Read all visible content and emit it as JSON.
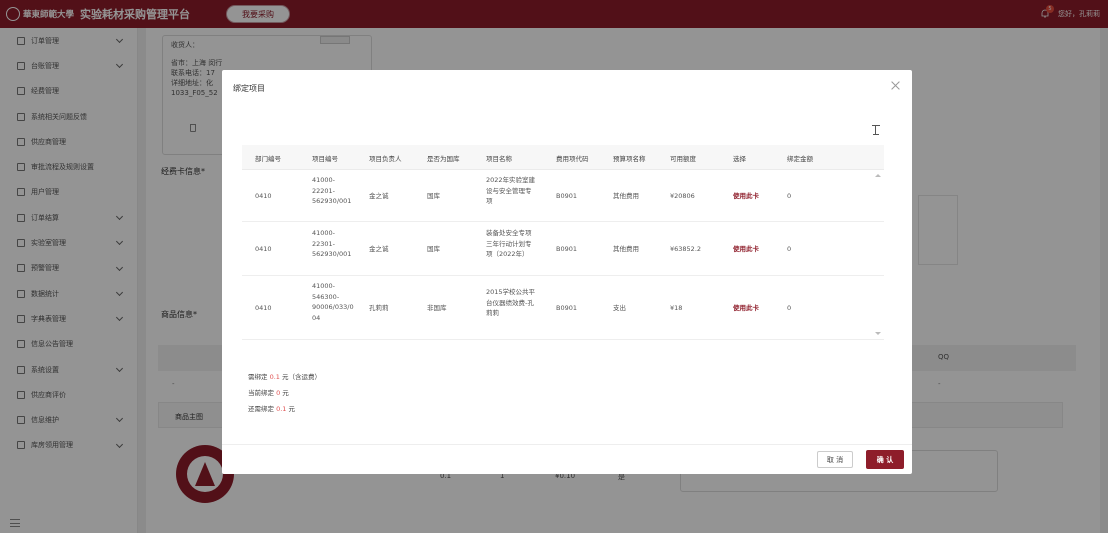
{
  "header": {
    "logo_text": "華東師範大學",
    "platform_title": "实验耗材采购管理平台",
    "buy_button": "我要采购",
    "notification_count": "5",
    "greeting": "您好，孔莉莉"
  },
  "sidebar": {
    "items": [
      {
        "label": "订单管理",
        "icon": "order-icon",
        "expandable": true
      },
      {
        "label": "台账管理",
        "icon": "ledger-icon",
        "expandable": true
      },
      {
        "label": "经费管理",
        "icon": "funding-icon",
        "expandable": false
      },
      {
        "label": "系统相关问题反馈",
        "icon": "feedback-icon",
        "expandable": false
      },
      {
        "label": "供应商管理",
        "icon": "supplier-icon",
        "expandable": false
      },
      {
        "label": "审批流程及规则设置",
        "icon": "approval-icon",
        "expandable": false
      },
      {
        "label": "用户管理",
        "icon": "user-icon",
        "expandable": false
      },
      {
        "label": "订单结算",
        "icon": "settlement-icon",
        "expandable": true
      },
      {
        "label": "实验室管理",
        "icon": "lab-icon",
        "expandable": true
      },
      {
        "label": "预警管理",
        "icon": "warning-icon",
        "expandable": true
      },
      {
        "label": "数据统计",
        "icon": "stats-icon",
        "expandable": true
      },
      {
        "label": "字典表管理",
        "icon": "dictionary-icon",
        "expandable": true
      },
      {
        "label": "信息公告管理",
        "icon": "announcement-icon",
        "expandable": false
      },
      {
        "label": "系统设置",
        "icon": "settings-icon",
        "expandable": true
      },
      {
        "label": "供应商评价",
        "icon": "star-icon",
        "expandable": false
      },
      {
        "label": "信息维护",
        "icon": "maintenance-icon",
        "expandable": true
      },
      {
        "label": "库房领用管理",
        "icon": "warehouse-icon",
        "expandable": true
      }
    ]
  },
  "background": {
    "address_lines": [
      "收货人：",
      "省市：上海 闵行",
      "联系电话：17",
      "详细地址：化",
      "1033_F05_52"
    ],
    "funding_card_label": "经费卡信息*",
    "goods_label": "商品信息*",
    "qq_header": "QQ",
    "dash": "-",
    "main_image_label": "商品主图",
    "row_values": [
      "0.1",
      "1",
      "¥0.10",
      "是"
    ]
  },
  "modal": {
    "title": "绑定项目",
    "columns": [
      "部门编号",
      "项目编号",
      "项目负责人",
      "是否为国库",
      "项目名称",
      "费用项代码",
      "预算项名称",
      "可用额度",
      "选择",
      "绑定金额"
    ],
    "rows": [
      {
        "dept": "0410",
        "project_no": "41000-\n22201-\n562930/001",
        "leader": "金之诚",
        "treasury": "国库",
        "name": "2022年实验室建\n设与安全管理专\n项",
        "cost_code": "B0901",
        "budget_item": "其他费用",
        "available": "¥20806",
        "select": "使用此卡",
        "bind_amount": "0"
      },
      {
        "dept": "0410",
        "project_no": "41000-\n22301-\n562930/001",
        "leader": "金之诚",
        "treasury": "国库",
        "name": "装备处安全专项\n三年行动计划专\n项（2022年）",
        "cost_code": "B0901",
        "budget_item": "其他费用",
        "available": "¥63852.2",
        "select": "使用此卡",
        "bind_amount": "0"
      },
      {
        "dept": "0410",
        "project_no": "41000-\n546300-\n90006/033/0\n04",
        "leader": "孔莉莉",
        "treasury": "非国库",
        "name": "2015学校公共平\n台仪器绩效费-孔\n莉莉",
        "cost_code": "B0901",
        "budget_item": "支出",
        "available": "¥18",
        "select": "使用此卡",
        "bind_amount": "0"
      }
    ],
    "summary": {
      "need_prefix": "需绑定",
      "need_value": "0.1",
      "need_suffix": "元（含运费）",
      "cur_prefix": "当前绑定",
      "cur_value": "0",
      "cur_suffix": "元",
      "left_prefix": "还需绑定",
      "left_value": "0.1",
      "left_suffix": "元"
    },
    "cancel_label": "取 消",
    "confirm_label": "确 认"
  }
}
